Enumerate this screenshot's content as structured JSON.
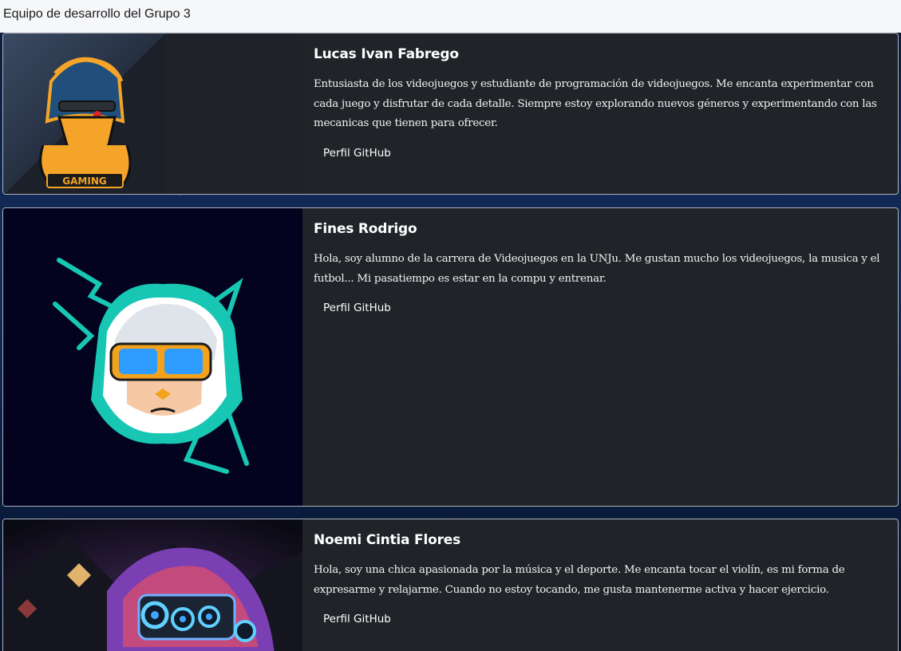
{
  "header": {
    "title": "Equipo de desarrollo del Grupo 3"
  },
  "members": [
    {
      "name": "Lucas Ivan Fabrego",
      "bio": "Entusiasta de los videojuegos y estudiante de programación de videojuegos. Me encanta experimentar con cada juego y disfrutar de cada detalle. Siempre estoy explorando nuevos géneros y experimentando con las mecanicas que tienen para ofrecer.",
      "link_label": "Perfil GitHub",
      "avatar_text": "GAMING",
      "avatar": "ninja-gaming-mascot"
    },
    {
      "name": "Fines Rodrigo",
      "bio": "Hola, soy alumno de la carrera de Videojuegos en la UNJu. Me gustan mucho los videojuegos, la musica y el futbol... Mi pasatiempo es estar en la compu y entrenar.",
      "link_label": "Perfil GitHub",
      "avatar": "goggles-lightning-mascot"
    },
    {
      "name": "Noemi Cintia Flores",
      "bio": "Hola, soy una chica apasionada por la música y el deporte. Me encanta tocar el violín, es mi forma de expresarme y relajarme. Cuando no estoy tocando, me gusta mantenerme activa y hacer ejercicio.",
      "link_label": "Perfil GitHub",
      "avatar": "night-vision-helmet-art"
    }
  ],
  "colors": {
    "card_bg": "#202327",
    "accent_teal": "#17c7b3",
    "header_bg": "#f6f7f9"
  }
}
